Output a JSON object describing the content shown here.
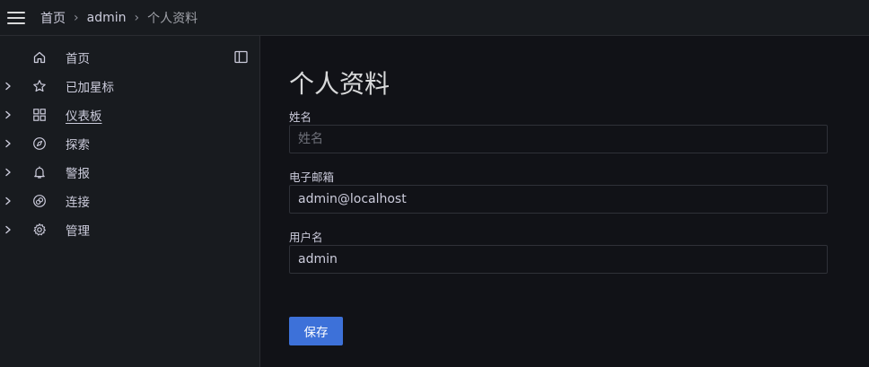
{
  "topbar": {
    "breadcrumbs": [
      "首页",
      "admin",
      "个人资料"
    ],
    "separator": "›"
  },
  "sidebar": {
    "items": [
      {
        "label": "首页",
        "icon": "home-icon",
        "has_children": false,
        "active": false
      },
      {
        "label": "已加星标",
        "icon": "star-icon",
        "has_children": true,
        "active": false
      },
      {
        "label": "仪表板",
        "icon": "apps-icon",
        "has_children": true,
        "active": true
      },
      {
        "label": "探索",
        "icon": "compass-icon",
        "has_children": true,
        "active": false
      },
      {
        "label": "警报",
        "icon": "bell-icon",
        "has_children": true,
        "active": false
      },
      {
        "label": "连接",
        "icon": "link-icon",
        "has_children": true,
        "active": false
      },
      {
        "label": "管理",
        "icon": "cog-icon",
        "has_children": true,
        "active": false
      }
    ]
  },
  "main": {
    "title": "个人资料",
    "fields": [
      {
        "label": "姓名",
        "value": "",
        "placeholder": "姓名"
      },
      {
        "label": "电子邮箱",
        "value": "admin@localhost",
        "placeholder": ""
      },
      {
        "label": "用户名",
        "value": "admin",
        "placeholder": ""
      }
    ],
    "save_label": "保存"
  },
  "colors": {
    "accent": "#3d71d9",
    "background": "#111217",
    "panel": "#181b1f",
    "border": "#2a2c31"
  }
}
